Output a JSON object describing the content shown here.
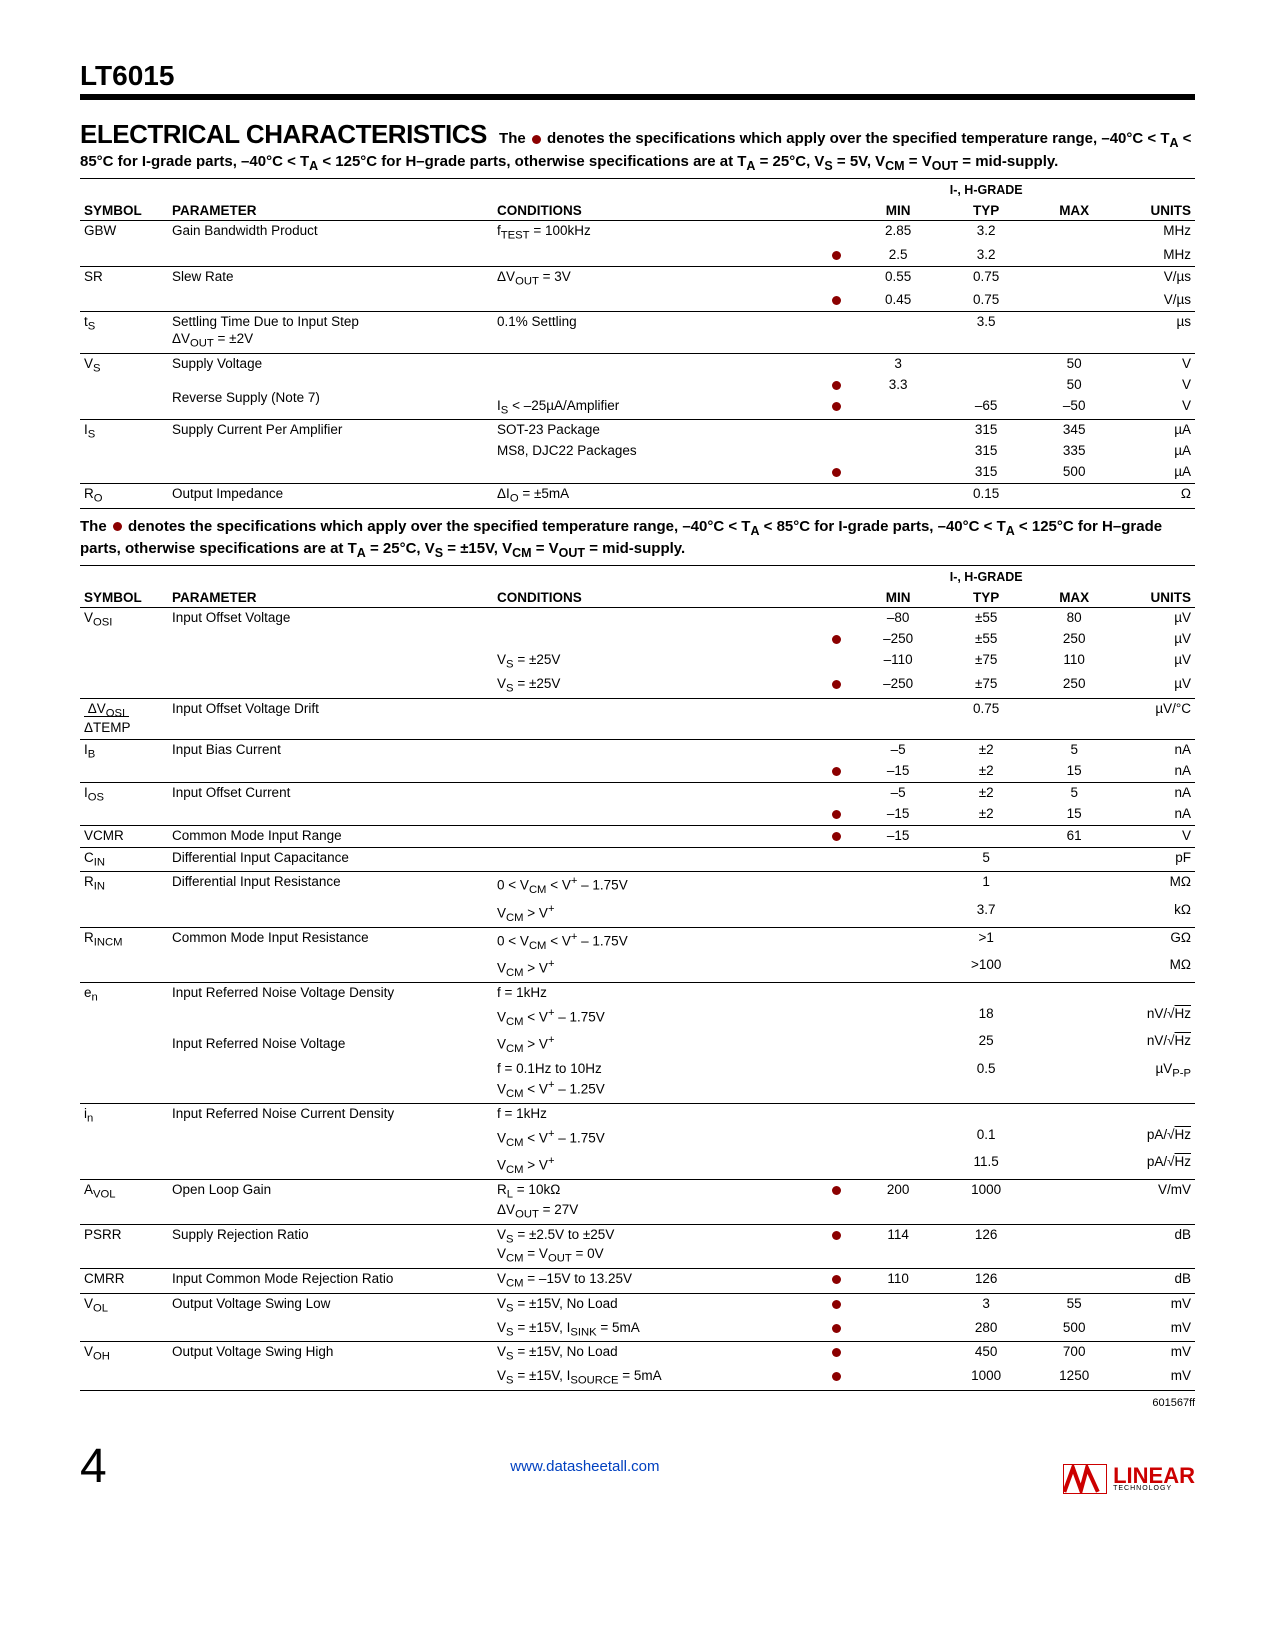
{
  "part": "LT6015",
  "section_title": "ELECTRICAL CHARACTERISTICS",
  "intro1a": "The ",
  "intro1b": " denotes the specifications which apply over the specified temperature range, –40°C < T",
  "intro1c": " < 85°C for I-grade parts, –40°C < T",
  "intro1d": " < 125°C for H–grade parts, otherwise specifications are at T",
  "intro1e": " = 25°C, V",
  "intro1f": " = 5V, V",
  "intro1g": " = V",
  "intro1h": " = mid-supply.",
  "hdr": {
    "symbol": "SYMBOL",
    "parameter": "PARAMETER",
    "conditions": "CONDITIONS",
    "grade": "I-, H-GRADE",
    "min": "MIN",
    "typ": "TYP",
    "max": "MAX",
    "units": "UNITS"
  },
  "t1": [
    {
      "sym": "GBW",
      "param": "Gain Bandwidth Product",
      "cond": [
        "f<sub>TEST</sub> = 100kHz",
        ""
      ],
      "dot": [
        "",
        "●"
      ],
      "min": [
        "2.85",
        "2.5"
      ],
      "typ": [
        "3.2",
        "3.2"
      ],
      "max": [
        "",
        ""
      ],
      "unit": [
        "MHz",
        "MHz"
      ]
    },
    {
      "sym": "SR",
      "param": "Slew Rate",
      "cond": [
        "ΔV<sub>OUT</sub> = 3V",
        ""
      ],
      "dot": [
        "",
        "●"
      ],
      "min": [
        "0.55",
        "0.45"
      ],
      "typ": [
        "0.75",
        "0.75"
      ],
      "max": [
        "",
        ""
      ],
      "unit": [
        "V/µs",
        "V/µs"
      ]
    },
    {
      "sym": "t<sub>S</sub>",
      "param": "Settling Time Due to Input Step<br>ΔV<sub>OUT</sub> = ±2V",
      "cond": [
        "0.1% Settling"
      ],
      "dot": [
        ""
      ],
      "min": [
        ""
      ],
      "typ": [
        "3.5"
      ],
      "max": [
        ""
      ],
      "unit": [
        "µs"
      ]
    },
    {
      "sym": "V<sub>S</sub>",
      "param": "Supply Voltage<br><br>Reverse Supply (Note 7)",
      "cond": [
        "",
        "",
        "I<sub>S</sub> < –25µA/Amplifier"
      ],
      "dot": [
        "",
        "●",
        "●"
      ],
      "min": [
        "3",
        "3.3",
        ""
      ],
      "typ": [
        "",
        "",
        "–65"
      ],
      "max": [
        "50",
        "50",
        "–50"
      ],
      "unit": [
        "V",
        "V",
        "V"
      ]
    },
    {
      "sym": "I<sub>S</sub>",
      "param": "Supply Current Per Amplifier",
      "cond": [
        "SOT-23 Package",
        "MS8, DJC22 Packages",
        ""
      ],
      "dot": [
        "",
        "",
        "●"
      ],
      "min": [
        "",
        "",
        ""
      ],
      "typ": [
        "315",
        "315",
        "315"
      ],
      "max": [
        "345",
        "335",
        "500"
      ],
      "unit": [
        "µA",
        "µA",
        "µA"
      ]
    },
    {
      "sym": "R<sub>O</sub>",
      "param": "Output Impedance",
      "cond": [
        "ΔI<sub>O</sub> = ±5mA"
      ],
      "dot": [
        ""
      ],
      "min": [
        ""
      ],
      "typ": [
        "0.15"
      ],
      "max": [
        ""
      ],
      "unit": [
        "Ω"
      ]
    }
  ],
  "mid1a": "The ",
  "mid1b": " denotes the specifications which apply over the specified temperature range, –40°C < T",
  "mid1c": " < 85°C for I-grade parts, –40°C < T",
  "mid1d": " < 125°C for H–grade parts, otherwise specifications are at T",
  "mid1e": " = 25°C, V",
  "mid1f": " = ±15V, V",
  "mid1g": " = V",
  "mid1h": " = mid-supply.",
  "t2": [
    {
      "sym": "V<sub>OSI</sub>",
      "param": "Input Offset Voltage",
      "cond": [
        "",
        "",
        "V<sub>S</sub> = ±25V",
        "V<sub>S</sub> = ±25V"
      ],
      "dot": [
        "",
        "●",
        "",
        "●"
      ],
      "min": [
        "–80",
        "–250",
        "–110",
        "–250"
      ],
      "typ": [
        "±55",
        "±55",
        "±75",
        "±75"
      ],
      "max": [
        "80",
        "250",
        "110",
        "250"
      ],
      "unit": [
        "µV",
        "µV",
        "µV",
        "µV"
      ]
    },
    {
      "sym": "<span style='border-bottom:1px solid #000'>&nbsp;ΔV<sub>OSI</sub>&nbsp;</span><br>ΔTEMP",
      "param": "Input Offset Voltage Drift",
      "cond": [
        ""
      ],
      "dot": [
        ""
      ],
      "min": [
        ""
      ],
      "typ": [
        "0.75"
      ],
      "max": [
        ""
      ],
      "unit": [
        "µV/°C"
      ]
    },
    {
      "sym": "I<sub>B</sub>",
      "param": "Input Bias Current",
      "cond": [
        "",
        ""
      ],
      "dot": [
        "",
        "●"
      ],
      "min": [
        "–5",
        "–15"
      ],
      "typ": [
        "±2",
        "±2"
      ],
      "max": [
        "5",
        "15"
      ],
      "unit": [
        "nA",
        "nA"
      ]
    },
    {
      "sym": "I<sub>OS</sub>",
      "param": "Input Offset Current",
      "cond": [
        "",
        ""
      ],
      "dot": [
        "",
        "●"
      ],
      "min": [
        "–5",
        "–15"
      ],
      "typ": [
        "±2",
        "±2"
      ],
      "max": [
        "5",
        "15"
      ],
      "unit": [
        "nA",
        "nA"
      ]
    },
    {
      "sym": "VCMR",
      "param": "Common Mode Input Range",
      "cond": [
        ""
      ],
      "dot": [
        "●"
      ],
      "min": [
        "–15"
      ],
      "typ": [
        ""
      ],
      "max": [
        "61"
      ],
      "unit": [
        "V"
      ]
    },
    {
      "sym": "C<sub>IN</sub>",
      "param": "Differential Input Capacitance",
      "cond": [
        ""
      ],
      "dot": [
        ""
      ],
      "min": [
        ""
      ],
      "typ": [
        "5"
      ],
      "max": [
        ""
      ],
      "unit": [
        "pF"
      ]
    },
    {
      "sym": "R<sub>IN</sub>",
      "param": "Differential Input Resistance",
      "cond": [
        "0 < V<sub>CM</sub> < V<sup>+</sup> – 1.75V",
        "V<sub>CM</sub> > V<sup>+</sup>"
      ],
      "dot": [
        "",
        ""
      ],
      "min": [
        "",
        ""
      ],
      "typ": [
        "1",
        "3.7"
      ],
      "max": [
        "",
        ""
      ],
      "unit": [
        "MΩ",
        "kΩ"
      ]
    },
    {
      "sym": "R<sub>INCM</sub>",
      "param": "Common Mode Input Resistance",
      "cond": [
        "0 < V<sub>CM</sub> < V<sup>+</sup> – 1.75V",
        "V<sub>CM</sub> > V<sup>+</sup>"
      ],
      "dot": [
        "",
        ""
      ],
      "min": [
        "",
        ""
      ],
      "typ": [
        ">1",
        ">100"
      ],
      "max": [
        "",
        ""
      ],
      "unit": [
        "GΩ",
        "MΩ"
      ]
    },
    {
      "sym": "e<sub>n</sub>",
      "param": "Input Referred Noise Voltage Density<br><br><br>Input Referred Noise Voltage",
      "cond": [
        "f = 1kHz",
        "V<sub>CM</sub> < V<sup>+</sup> – 1.75V",
        "V<sub>CM</sub> > V<sup>+</sup>",
        "f = 0.1Hz to 10Hz<br>V<sub>CM</sub> < V<sup>+</sup> – 1.25V"
      ],
      "dot": [
        "",
        "",
        "",
        ""
      ],
      "min": [
        "",
        "",
        "",
        ""
      ],
      "typ": [
        "",
        "18",
        "25",
        "0.5"
      ],
      "max": [
        "",
        "",
        "",
        ""
      ],
      "unit": [
        "",
        "nV/√<span style=\"text-decoration:overline\">Hz</span>",
        "nV/√<span style=\"text-decoration:overline\">Hz</span>",
        "µV<sub>P-P</sub>"
      ]
    },
    {
      "sym": "i<sub>n</sub>",
      "param": "Input Referred Noise Current Density",
      "cond": [
        "f = 1kHz",
        "V<sub>CM</sub> < V<sup>+</sup> – 1.75V",
        "V<sub>CM</sub> > V<sup>+</sup>"
      ],
      "dot": [
        "",
        "",
        ""
      ],
      "min": [
        "",
        "",
        ""
      ],
      "typ": [
        "",
        "0.1",
        "11.5"
      ],
      "max": [
        "",
        "",
        ""
      ],
      "unit": [
        "",
        "pA/√<span style=\"text-decoration:overline\">Hz</span>",
        "pA/√<span style=\"text-decoration:overline\">Hz</span>"
      ]
    },
    {
      "sym": "A<sub>VOL</sub>",
      "param": "Open Loop Gain",
      "cond": [
        "R<sub>L</sub> = 10kΩ<br>ΔV<sub>OUT</sub> = 27V"
      ],
      "dot": [
        "●"
      ],
      "min": [
        "200"
      ],
      "typ": [
        "1000"
      ],
      "max": [
        ""
      ],
      "unit": [
        "V/mV"
      ]
    },
    {
      "sym": "PSRR",
      "param": "Supply Rejection Ratio",
      "cond": [
        "V<sub>S</sub> = ±2.5V to ±25V<br>V<sub>CM</sub> = V<sub>OUT</sub> = 0V"
      ],
      "dot": [
        "●"
      ],
      "min": [
        "114"
      ],
      "typ": [
        "126"
      ],
      "max": [
        ""
      ],
      "unit": [
        "dB"
      ]
    },
    {
      "sym": "CMRR",
      "param": "Input Common Mode Rejection Ratio",
      "cond": [
        "V<sub>CM</sub> = –15V to 13.25V"
      ],
      "dot": [
        "●"
      ],
      "min": [
        "110"
      ],
      "typ": [
        "126"
      ],
      "max": [
        ""
      ],
      "unit": [
        "dB"
      ]
    },
    {
      "sym": "V<sub>OL</sub>",
      "param": "Output Voltage Swing Low",
      "cond": [
        "V<sub>S</sub> = ±15V, No Load",
        "V<sub>S</sub> = ±15V, I<sub>SINK</sub> = 5mA"
      ],
      "dot": [
        "●",
        "●"
      ],
      "min": [
        "",
        ""
      ],
      "typ": [
        "3",
        "280"
      ],
      "max": [
        "55",
        "500"
      ],
      "unit": [
        "mV",
        "mV"
      ]
    },
    {
      "sym": "V<sub>OH</sub>",
      "param": "Output Voltage Swing High",
      "cond": [
        "V<sub>S</sub> = ±15V, No Load",
        "V<sub>S</sub> = ±15V, I<sub>SOURCE</sub> = 5mA"
      ],
      "dot": [
        "●",
        "●"
      ],
      "min": [
        "",
        ""
      ],
      "typ": [
        "450",
        "1000"
      ],
      "max": [
        "700",
        "1250"
      ],
      "unit": [
        "mV",
        "mV"
      ]
    }
  ],
  "doc_code": "601567ff",
  "page_num": "4",
  "footer_link": "www.datasheetall.com",
  "logo_big": "LINEAR",
  "logo_small": "TECHNOLOGY"
}
